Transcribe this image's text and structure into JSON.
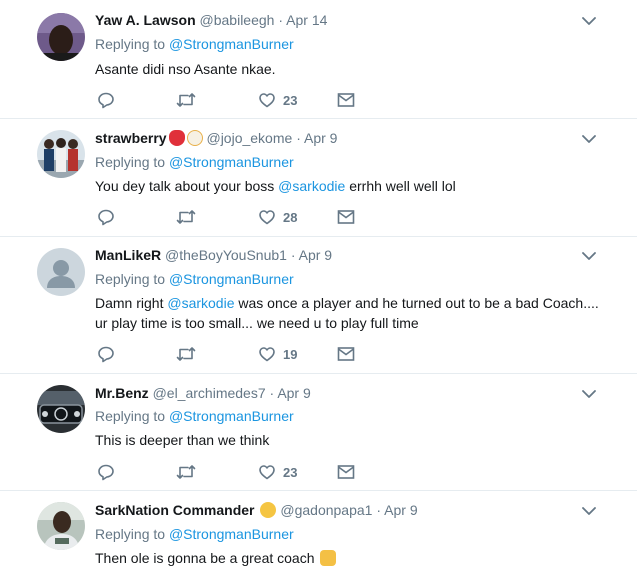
{
  "tweets": [
    {
      "name": "Yaw A. Lawson",
      "handle": "@babileegh",
      "time": "Apr 14",
      "replying_prefix": "Replying to",
      "replying_to": "@StrongmanBurner",
      "text_parts": [
        "Asante didi nso Asante nkae.",
        "",
        ""
      ],
      "likes": "23",
      "emoji": [],
      "avatar": "photo-dark-face"
    },
    {
      "name": "strawberry",
      "handle": "@jojo_ekome",
      "time": "Apr 9",
      "replying_prefix": "Replying to",
      "replying_to": "@StrongmanBurner",
      "text_parts": [
        "You dey talk about your boss ",
        "@sarkodie",
        " errhh well well lol"
      ],
      "likes": "28",
      "emoji": [
        "strawberry-emoji",
        "clown-emoji"
      ],
      "avatar": "photo-group"
    },
    {
      "name": "ManLikeR",
      "handle": "@theBoyYouSnub1",
      "time": "Apr 9",
      "replying_prefix": "Replying to",
      "replying_to": "@StrongmanBurner",
      "text_parts": [
        "Damn right ",
        "@sarkodie",
        " was once a player and he turned out to be a bad Coach.... ur play time is too small... we need u to play full time"
      ],
      "likes": "19",
      "emoji": [],
      "avatar": "default-avatar"
    },
    {
      "name": "Mr.Benz",
      "handle": "@el_archimedes7",
      "time": "Apr 9",
      "replying_prefix": "Replying to",
      "replying_to": "@StrongmanBurner",
      "text_parts": [
        "This is deeper than we think",
        "",
        ""
      ],
      "likes": "23",
      "emoji": [],
      "avatar": "photo-car-grille"
    },
    {
      "name": "SarkNation Commander",
      "handle": "@gadonpapa1",
      "time": "Apr 9",
      "replying_prefix": "Replying to",
      "replying_to": "@StrongmanBurner",
      "text_parts": [
        "Then ole is gonna be a great coach",
        "",
        ""
      ],
      "likes": "",
      "emoji": [
        "sunglasses-emoji"
      ],
      "trailing_emoji": "raised-hands-emoji",
      "avatar": "photo-man-grey"
    }
  ],
  "separator": "·",
  "colors": {
    "link": "#1b95e0",
    "muted": "#657786",
    "border": "#e6ecf0"
  }
}
